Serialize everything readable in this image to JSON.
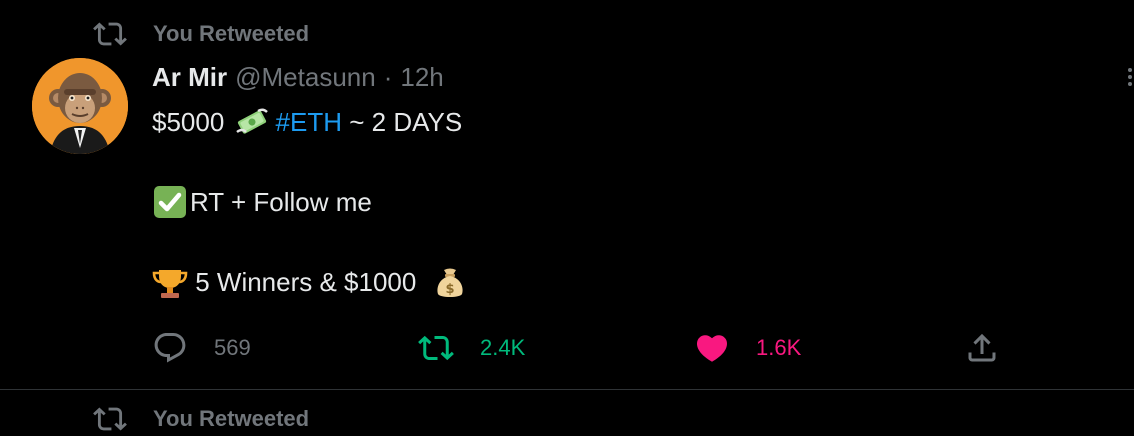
{
  "retweet_context": {
    "label": "You Retweeted",
    "icon": "retweet-icon"
  },
  "tweet": {
    "author_name": "Ar Mir",
    "handle": "@Metasunn",
    "separator": "·",
    "time": "12h",
    "lines": [
      {
        "prefix": "$5000 ",
        "emoji": "money-with-wings",
        "hashtag": "#ETH",
        "suffix": " ~ 2 DAYS"
      },
      {
        "emoji": "white-check-mark",
        "text": "RT + Follow me"
      },
      {
        "emoji": "trophy",
        "text": " 5 Winners & $1000 ",
        "trailing_emoji": "money-bag"
      }
    ]
  },
  "actions": {
    "reply_count": "569",
    "retweet_count": "2.4K",
    "like_count": "1.6K"
  },
  "colors": {
    "background": "#000000",
    "muted": "#71767b",
    "hashtag": "#1d9bf0",
    "retweet": "#00ba7c",
    "like": "#f91880",
    "avatar_bg": "#f0962c"
  },
  "next_retweet_context": {
    "label": "You Retweeted"
  }
}
